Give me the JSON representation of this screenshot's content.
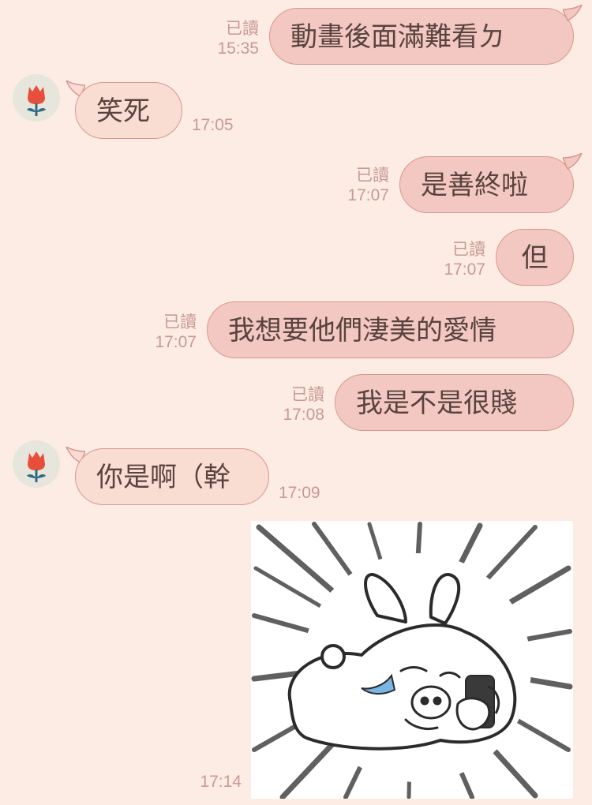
{
  "messages": [
    {
      "sender": "me",
      "text": "動畫後面滿難看ㄉ",
      "read": "已讀",
      "time": "15:35"
    },
    {
      "sender": "friend",
      "text": "笑死",
      "time": "17:05"
    },
    {
      "sender": "me",
      "text": "是善終啦",
      "read": "已讀",
      "time": "17:07"
    },
    {
      "sender": "me",
      "text": "但",
      "read": "已讀",
      "time": "17:07"
    },
    {
      "sender": "me",
      "text": "我想要他們淒美的愛情",
      "read": "已讀",
      "time": "17:07"
    },
    {
      "sender": "me",
      "text": "我是不是很賤",
      "read": "已讀",
      "time": "17:08"
    },
    {
      "sender": "friend",
      "text": "你是啊（幹",
      "time": "17:09"
    },
    {
      "sender": "me",
      "sticker": "crying-rabbit-lying-with-phone",
      "time": "17:14"
    }
  ],
  "avatar_icon": "red-tulip-icon",
  "colors": {
    "background": "#fdece3",
    "bubble_outgoing": "#f4c8c2",
    "bubble_incoming": "#f9dcd2",
    "bubble_border": "#d8978f",
    "text": "#58433f",
    "meta": "#c79a94",
    "flower_red": "#e74f3c",
    "flower_stem": "#2e6a83"
  }
}
